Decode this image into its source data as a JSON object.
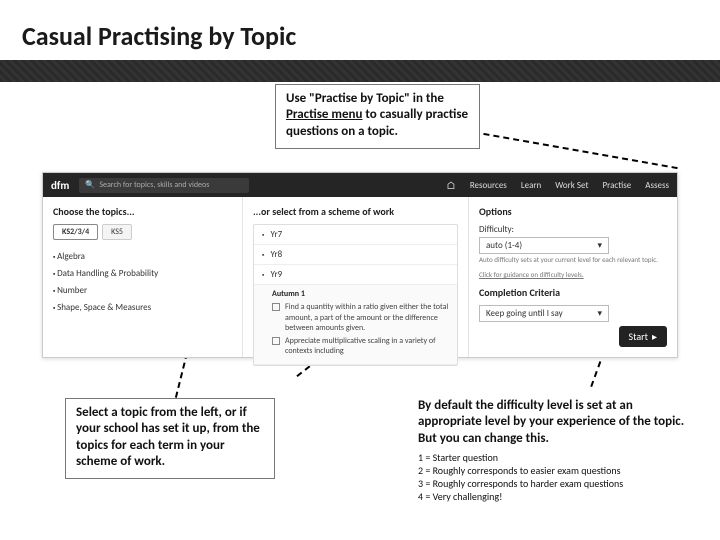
{
  "title": "Casual Practising by Topic",
  "callouts": {
    "top": {
      "pre": "Use \"Practise by Topic\" in the ",
      "underlined": "Practise menu",
      "post": " to casually practise questions on a topic."
    },
    "bottom_left": "Select a topic from the left, or if your school has set it up, from the topics for each term in your scheme of work.",
    "bottom_right_main": "By default the difficulty level is set at an appropriate level by your experience of the topic. But you can change this.",
    "defs": [
      "1 = Starter question",
      "2 = Roughly corresponds to easier exam questions",
      "3 = Roughly corresponds to harder exam questions",
      "4 = Very challenging!"
    ]
  },
  "screenshot": {
    "logo": "dfm",
    "search_placeholder": "Search for topics, skills and videos",
    "nav": [
      "Resources",
      "Learn",
      "Work Set",
      "Practise",
      "Assess"
    ],
    "col1": {
      "header": "Choose the topics...",
      "tabs": [
        "KS2/3/4",
        "KS5"
      ],
      "topics": [
        "Algebra",
        "Data Handling & Probability",
        "Number",
        "Shape, Space & Measures"
      ]
    },
    "col2": {
      "header": "...or select from a scheme of work",
      "years": [
        "Yr7",
        "Yr8",
        "Yr9"
      ],
      "open_term": "Autumn 1",
      "item1": "Find a quantity within a ratio given either the total amount, a part of the amount or the difference between amounts given.",
      "item2": "Appreciate multiplicative scaling in a variety of contexts including"
    },
    "col3": {
      "header": "Options",
      "difficulty_label": "Difficulty:",
      "difficulty_value": "auto (1-4)",
      "difficulty_hint1": "Auto difficulty sets at your current level for each relevant topic.",
      "difficulty_hint2": "Click for guidance on difficulty levels.",
      "completion_header": "Completion Criteria",
      "completion_value": "Keep going until I say",
      "start": "Start"
    }
  }
}
